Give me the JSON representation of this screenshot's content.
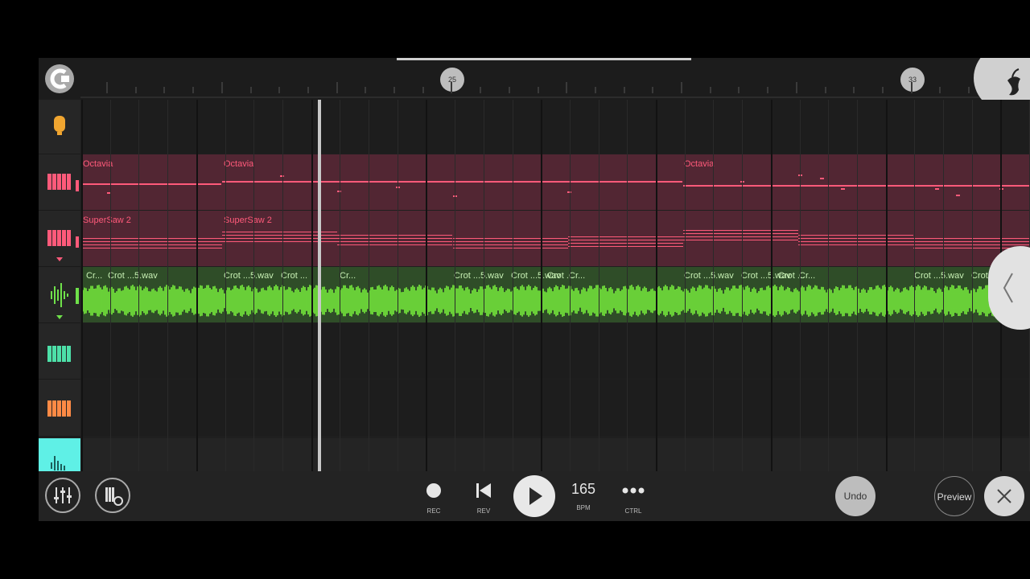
{
  "ruler": {
    "markers": [
      "25",
      "33"
    ]
  },
  "tracks": [
    {
      "name": "mic-track",
      "icon": "microphone-icon",
      "color": "#f0a530"
    },
    {
      "name": "octavia-track",
      "icon": "piano-keys-icon",
      "color": "#ff5a7a",
      "clips": [
        "Octavia",
        "Octavia",
        "Octavia"
      ]
    },
    {
      "name": "supersaw-track",
      "icon": "piano-keys-icon",
      "color": "#ff5a7a",
      "clips": [
        "SuperSaw 2",
        "SuperSaw 2"
      ]
    },
    {
      "name": "audio-track",
      "icon": "waveform-icon",
      "color": "#6fe14a",
      "clips": [
        "Cr...",
        "Crot ...5.wav",
        "Crot ...5.wav",
        "Crot ...",
        "Cr...",
        "Crot ...5.wav",
        "Crot ...5.wav",
        "Crot ...",
        "Cr...",
        "Crot ...5.wav",
        "Crot ...5.wav",
        "Crot ...",
        "Cr...",
        "Crot ...5.wav",
        "Crot ...5.wav",
        "Crot"
      ]
    },
    {
      "name": "teal-keys-track",
      "icon": "piano-keys-icon",
      "color": "#4de0a8"
    },
    {
      "name": "orange-keys-track",
      "icon": "piano-keys-icon",
      "color": "#ff8a45"
    },
    {
      "name": "sampler-track",
      "icon": "waveform-icon",
      "color": "#5ff0e6"
    }
  ],
  "transport": {
    "rec_label": "REC",
    "rev_label": "REV",
    "bpm_value": "165",
    "bpm_label": "BPM",
    "ctrl_label": "CTRL",
    "undo_label": "Undo",
    "preview_label": "Preview"
  },
  "colors": {
    "background": "#1f1f1f",
    "pink_lane": "#5c2835",
    "pink_note": "#ff5a7a",
    "green_lane": "#2f4d28",
    "green_wave": "#78f03c"
  }
}
